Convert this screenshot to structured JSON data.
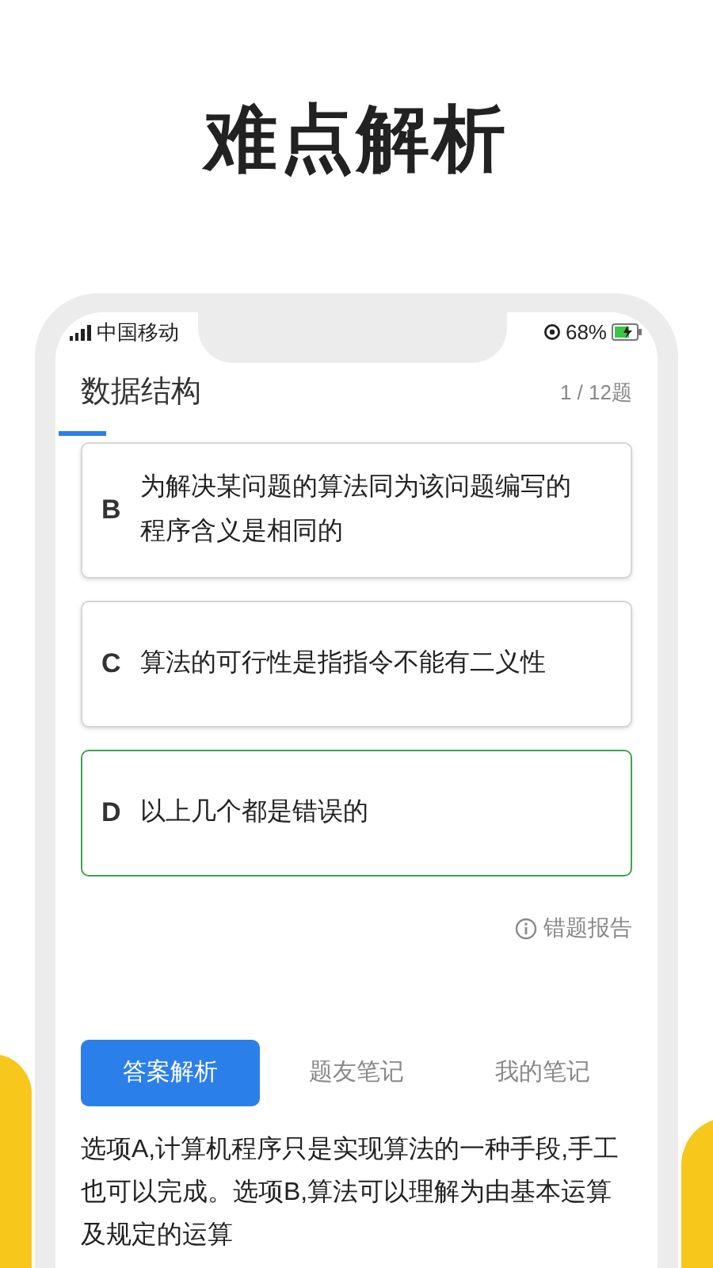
{
  "headline": "难点解析",
  "status_bar": {
    "carrier": "中国移动",
    "battery": "68%"
  },
  "title": "数据结构",
  "progress": "1 / 12题",
  "options": [
    {
      "letter": "B",
      "text": "为解决某问题的算法同为该问题编写的程序含义是相同的",
      "selected": false
    },
    {
      "letter": "C",
      "text": "算法的可行性是指指令不能有二义性",
      "selected": false
    },
    {
      "letter": "D",
      "text": "以上几个都是错误的",
      "selected": true
    }
  ],
  "report": "错题报告",
  "tabs": [
    {
      "label": "答案解析",
      "selected": true
    },
    {
      "label": "题友笔记",
      "selected": false
    },
    {
      "label": "我的笔记",
      "selected": false
    }
  ],
  "explanation": "选项A,计算机程序只是实现算法的一种手段,手工也可以完成。选项B,算法可以理解为由基本运算及规定的运算"
}
